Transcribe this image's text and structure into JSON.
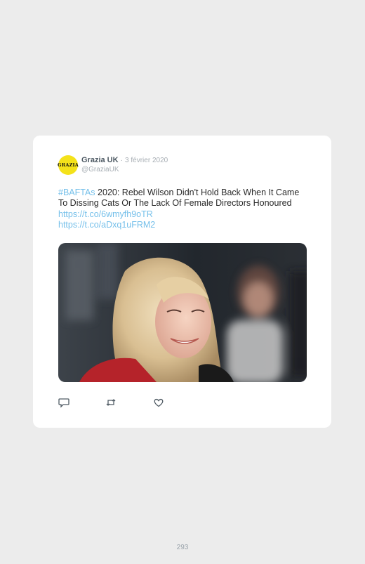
{
  "tweet": {
    "author_name": "Grazia UK",
    "separator": "·",
    "date": "3 février 2020",
    "handle": "@GraziaUK",
    "avatar_text": "GRAZIA",
    "text": {
      "hashtag": "#BAFTAs",
      "body": " 2020: Rebel Wilson Didn't Hold Back When It Came To Dissing Cats Or The Lack Of Female Directors Honoured ",
      "link1": "https://t.co/6wmyfh9oTR",
      "link2": "https://t.co/aDxq1uFRM2"
    },
    "actions": [
      {
        "name": "reply",
        "icon": "comment-icon"
      },
      {
        "name": "retweet",
        "icon": "retweet-icon"
      },
      {
        "name": "like",
        "icon": "heart-icon"
      }
    ]
  },
  "page": {
    "number": "293"
  },
  "colors": {
    "background": "#ececec",
    "card": "#ffffff",
    "link": "#76c0ea",
    "muted": "#a6adb3",
    "avatar_bg": "#f4e21a"
  }
}
